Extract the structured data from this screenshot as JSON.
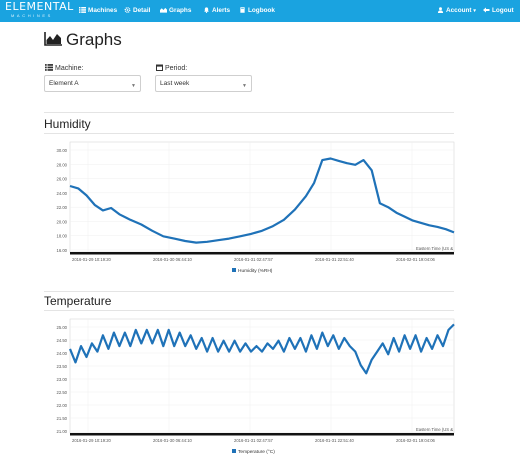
{
  "navbar": {
    "brand": "ELEMENTAL",
    "brand_sub": "MACHINES",
    "items": [
      {
        "label": "Machines",
        "icon": "list-icon"
      },
      {
        "label": "Detail",
        "icon": "gear-icon"
      },
      {
        "label": "Graphs",
        "icon": "area-chart-icon"
      },
      {
        "label": "Alerts",
        "icon": "bell-icon"
      },
      {
        "label": "Logbook",
        "icon": "book-icon"
      }
    ],
    "account": "Account",
    "logout": "Logout",
    "color": "#1aa3e0"
  },
  "page": {
    "title": "Graphs"
  },
  "filters": {
    "machine_label": "Machine:",
    "machine_value": "Element A",
    "period_label": "Period:",
    "period_value": "Last week"
  },
  "chart_data": [
    {
      "type": "line",
      "title": "Humidity",
      "legend": "Humidity (%RH)",
      "timezone_note": "Eastern Time (US &",
      "ylim": [
        17,
        31
      ],
      "y_ticks": [
        "30.00",
        "28.00",
        "26.00",
        "24.00",
        "22.00",
        "20.00",
        "18.00",
        "16.00"
      ],
      "x_ticks": [
        "2016-01-29 10:19:20",
        "2016-01-30 06:44:10",
        "2016-01-31 02:47:57",
        "2016-01-31 22:51:40",
        "2016-02-01 19:04:06"
      ],
      "color": "#1f72b8",
      "series": [
        {
          "name": "Humidity (%RH)",
          "values": [
            [
              0,
              25.4
            ],
            [
              3,
              25.1
            ],
            [
              6,
              24.2
            ],
            [
              9,
              23.0
            ],
            [
              12,
              22.3
            ],
            [
              15,
              22.6
            ],
            [
              18,
              21.8
            ],
            [
              22,
              21.1
            ],
            [
              26,
              20.5
            ],
            [
              30,
              19.7
            ],
            [
              34,
              19.0
            ],
            [
              38,
              18.7
            ],
            [
              42,
              18.4
            ],
            [
              46,
              18.2
            ],
            [
              50,
              18.3
            ],
            [
              54,
              18.5
            ],
            [
              58,
              18.7
            ],
            [
              62,
              19.0
            ],
            [
              66,
              19.3
            ],
            [
              70,
              19.7
            ],
            [
              74,
              20.3
            ],
            [
              78,
              21.1
            ],
            [
              82,
              22.4
            ],
            [
              86,
              24.1
            ],
            [
              89,
              25.8
            ],
            [
              92,
              28.7
            ],
            [
              95,
              28.9
            ],
            [
              98,
              28.6
            ],
            [
              101,
              28.3
            ],
            [
              104,
              28.1
            ],
            [
              107,
              28.7
            ],
            [
              110,
              27.4
            ],
            [
              113,
              23.2
            ],
            [
              116,
              22.7
            ],
            [
              119,
              22.0
            ],
            [
              122,
              21.5
            ],
            [
              125,
              21.0
            ],
            [
              128,
              20.7
            ],
            [
              131,
              20.4
            ],
            [
              134,
              20.2
            ],
            [
              137,
              19.9
            ],
            [
              140,
              19.5
            ]
          ]
        }
      ]
    },
    {
      "type": "line",
      "title": "Temperature",
      "legend": "Temperature (°C)",
      "timezone_note": "Eastern Time (US &",
      "ylim": [
        21,
        25.2
      ],
      "y_ticks": [
        "25.00",
        "24.50",
        "24.00",
        "23.50",
        "23.00",
        "22.50",
        "22.00",
        "21.50",
        "21.00"
      ],
      "x_ticks": [
        "2016-01-29 10:19:20",
        "2016-01-30 06:44:10",
        "2016-01-31 02:47:57",
        "2016-01-31 22:51:40",
        "2016-02-01 19:04:06"
      ],
      "color": "#1f72b8",
      "series": [
        {
          "name": "Temperature (°C)",
          "values": [
            [
              0,
              24.1
            ],
            [
              2,
              23.6
            ],
            [
              4,
              24.2
            ],
            [
              6,
              23.8
            ],
            [
              8,
              24.3
            ],
            [
              10,
              24.0
            ],
            [
              12,
              24.6
            ],
            [
              14,
              24.1
            ],
            [
              16,
              24.7
            ],
            [
              18,
              24.2
            ],
            [
              20,
              24.7
            ],
            [
              22,
              24.2
            ],
            [
              24,
              24.8
            ],
            [
              26,
              24.3
            ],
            [
              28,
              24.8
            ],
            [
              30,
              24.3
            ],
            [
              32,
              24.8
            ],
            [
              34,
              24.2
            ],
            [
              36,
              24.8
            ],
            [
              38,
              24.2
            ],
            [
              40,
              24.7
            ],
            [
              42,
              24.2
            ],
            [
              44,
              24.6
            ],
            [
              46,
              24.1
            ],
            [
              48,
              24.5
            ],
            [
              50,
              24.0
            ],
            [
              52,
              24.5
            ],
            [
              54,
              24.0
            ],
            [
              56,
              24.4
            ],
            [
              58,
              24.0
            ],
            [
              60,
              24.4
            ],
            [
              62,
              24.0
            ],
            [
              64,
              24.3
            ],
            [
              66,
              24.0
            ],
            [
              68,
              24.2
            ],
            [
              70,
              24.0
            ],
            [
              72,
              24.3
            ],
            [
              74,
              24.1
            ],
            [
              76,
              24.4
            ],
            [
              78,
              24.0
            ],
            [
              80,
              24.5
            ],
            [
              82,
              24.1
            ],
            [
              84,
              24.5
            ],
            [
              86,
              24.0
            ],
            [
              88,
              24.6
            ],
            [
              90,
              24.1
            ],
            [
              92,
              24.7
            ],
            [
              94,
              24.2
            ],
            [
              96,
              24.6
            ],
            [
              98,
              24.1
            ],
            [
              100,
              24.5
            ],
            [
              102,
              24.2
            ],
            [
              104,
              24.0
            ],
            [
              106,
              23.5
            ],
            [
              108,
              23.2
            ],
            [
              110,
              23.7
            ],
            [
              112,
              24.0
            ],
            [
              114,
              24.3
            ],
            [
              116,
              23.9
            ],
            [
              118,
              24.5
            ],
            [
              120,
              24.0
            ],
            [
              122,
              24.6
            ],
            [
              124,
              24.1
            ],
            [
              126,
              24.6
            ],
            [
              128,
              24.0
            ],
            [
              130,
              24.5
            ],
            [
              132,
              24.1
            ],
            [
              134,
              24.6
            ],
            [
              136,
              24.2
            ],
            [
              138,
              24.8
            ],
            [
              140,
              25.0
            ]
          ]
        }
      ]
    }
  ]
}
